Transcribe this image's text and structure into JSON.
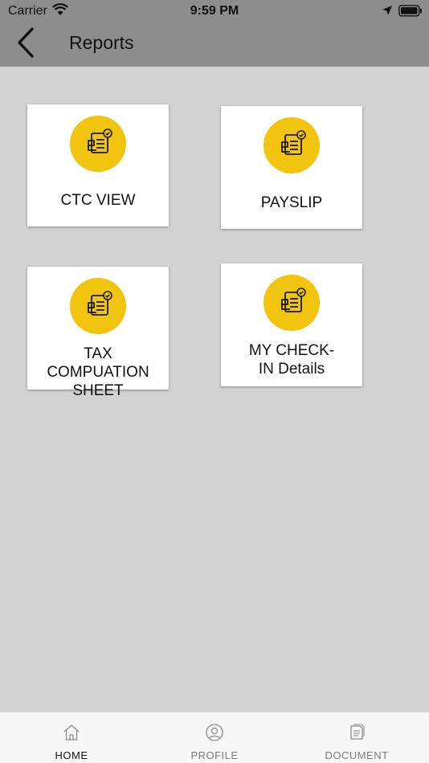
{
  "status": {
    "carrier": "Carrier",
    "time": "9:59 PM"
  },
  "header": {
    "title": "Reports"
  },
  "cards": [
    {
      "label": "CTC VIEW",
      "icon": "report-icon"
    },
    {
      "label": "PAYSLIP",
      "icon": "report-icon"
    },
    {
      "label": "TAX COMPUATION SHEET",
      "icon": "report-icon"
    },
    {
      "label": "MY CHECK-IN Details",
      "icon": "report-icon"
    }
  ],
  "tabs": [
    {
      "label": "HOME",
      "icon": "home-icon",
      "active": true
    },
    {
      "label": "PROFILE",
      "icon": "profile-icon",
      "active": false
    },
    {
      "label": "DOCUMENT",
      "icon": "document-icon",
      "active": false
    }
  ],
  "colors": {
    "accent": "#f1c40f",
    "header": "#8d8d8d",
    "background": "#d3d2d3"
  }
}
